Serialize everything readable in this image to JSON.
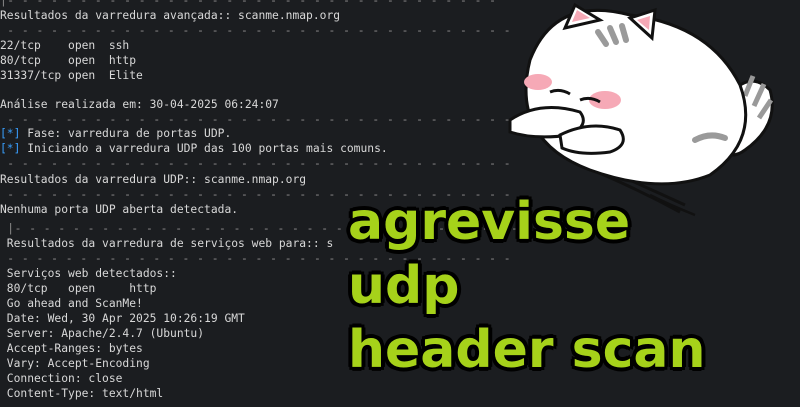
{
  "terminal": {
    "top_rule": "|- - - - - - - - - - - - - - - - - - - - - - - - - - - - - - - - - -",
    "adv_header": "Resultados da varredura avançada:: scanme.nmap.org",
    "rule2": " - - - - - - - - - - - - - - - - - - - - - - - - - - - - - - - - - - -",
    "ports": [
      "22/tcp    open  ssh",
      "80/tcp    open  http",
      "31337/tcp open  Elite"
    ],
    "analysis": "Análise realizada em: 30-04-2025 06:24:07",
    "rule3": " - - - - - - - - - - - - - - - - - - - - - - - - - - - - - - - - - - -",
    "phase_marker": "[*]",
    "phase_text": " Fase: varredura de portas UDP.",
    "udp_marker": "[*]",
    "udp_text": " Iniciando a varredura UDP das 100 portas mais comuns.",
    "rule4": " - - - - - - - - - - - - - - - - - - - - - - - - - - - - - - - - - - -",
    "udp_header": "Resultados da varredura UDP:: scanme.nmap.org",
    "rule5": " - - - - - - - - - - - - - - - - - - - - - - - - - - - - - - - - - - -",
    "udp_none": "Nenhuma porta UDP aberta detectada.",
    "rule6": " |- - - - - - - - - - - - - - - - - - - - - - - - - - - - - - - - - - -",
    "web_header": " Resultados da varredura de serviços web para:: s",
    "rule7": " - - - - - - - - - - - - - - - - - - - - - - - - - - - - - - - - - - -",
    "web_lines": [
      " Serviços web detectados::",
      " 80/tcp   open     http",
      " Go ahead and ScanMe!",
      " Date: Wed, 30 Apr 2025 10:26:19 GMT",
      " Server: Apache/2.4.7 (Ubuntu)",
      " Accept-Ranges: bytes",
      " Vary: Accept-Encoding",
      " Connection: close",
      " Content-Type: text/html"
    ]
  },
  "overlay": {
    "line1": "agrevisse",
    "line2": "udp",
    "line3": "header scan",
    "color": "#a6d21a"
  },
  "colors": {
    "background": "#1b1d20",
    "marker_blue": "#39a0ff"
  }
}
